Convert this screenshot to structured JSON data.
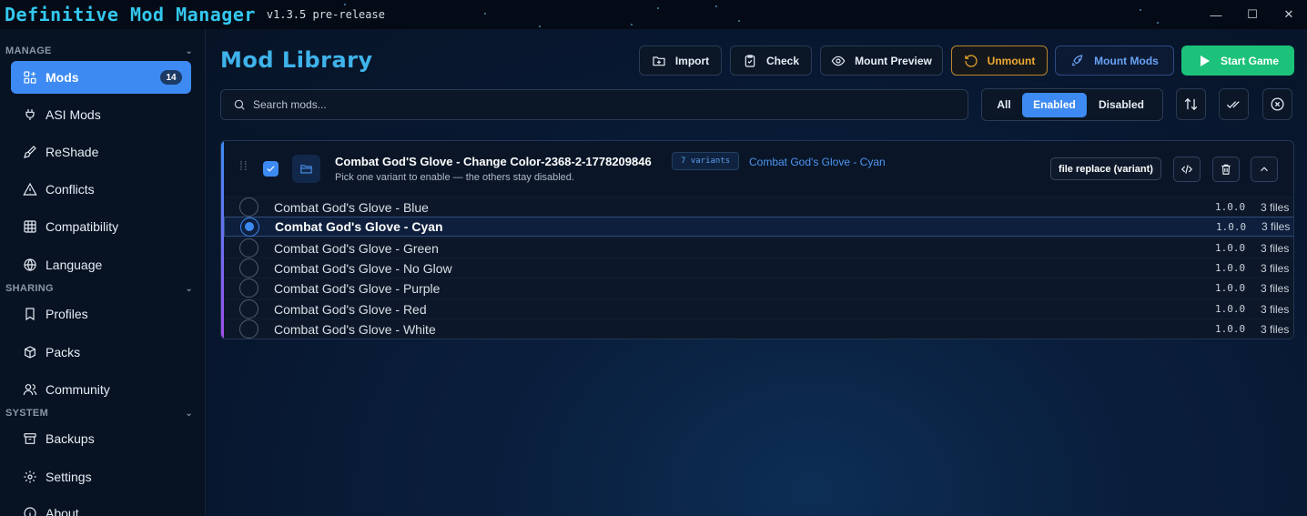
{
  "app": {
    "title": "Definitive Mod Manager",
    "version": "v1.3.5 pre-release",
    "accent_color": "#3d8af2"
  },
  "window_controls": {
    "minimize": "—",
    "maximize": "☐",
    "close": "✕"
  },
  "sidebar": {
    "sections": [
      {
        "label": "MANAGE"
      },
      {
        "label": "SHARING"
      },
      {
        "label": "SYSTEM"
      }
    ],
    "items": [
      {
        "label": "Mods",
        "icon": "mods-icon",
        "badge": "14",
        "active": true
      },
      {
        "label": "ASI Mods",
        "icon": "plug-icon"
      },
      {
        "label": "ReShade",
        "icon": "brush-icon"
      },
      {
        "label": "Conflicts",
        "icon": "warning-icon"
      },
      {
        "label": "Compatibility",
        "icon": "grid-icon"
      },
      {
        "label": "Language",
        "icon": "globe-icon"
      },
      {
        "label": "Profiles",
        "icon": "bookmark-icon"
      },
      {
        "label": "Packs",
        "icon": "package-icon"
      },
      {
        "label": "Community",
        "icon": "users-icon"
      },
      {
        "label": "Backups",
        "icon": "archive-icon"
      },
      {
        "label": "Settings",
        "icon": "gear-icon"
      },
      {
        "label": "About",
        "icon": "info-icon"
      }
    ]
  },
  "main": {
    "title": "Mod Library",
    "toolbar": {
      "import": "Import",
      "check": "Check",
      "mount_preview": "Mount Preview",
      "unmount": "Unmount",
      "mount_mods": "Mount Mods",
      "start_game": "Start Game"
    },
    "search": {
      "placeholder": "Search mods...",
      "value": ""
    },
    "filters": {
      "all": "All",
      "enabled": "Enabled",
      "disabled": "Disabled",
      "selected": "Enabled"
    }
  },
  "mod": {
    "name": "Combat God'S Glove - Change Color-2368-2-1778209846",
    "enabled": true,
    "variants_count": "7 variants",
    "selected_variant": "Combat God's Glove - Cyan",
    "description": "Pick one variant to enable — the others stay disabled.",
    "type": "file replace (variant)",
    "variants": [
      {
        "name": "Combat God's Glove - Blue",
        "version": "1.0.0",
        "files": "3 files",
        "selected": false
      },
      {
        "name": "Combat God's Glove - Cyan",
        "version": "1.0.0",
        "files": "3 files",
        "selected": true
      },
      {
        "name": "Combat God's Glove - Green",
        "version": "1.0.0",
        "files": "3 files",
        "selected": false
      },
      {
        "name": "Combat God's Glove - No Glow",
        "version": "1.0.0",
        "files": "3 files",
        "selected": false
      },
      {
        "name": "Combat God's Glove - Purple",
        "version": "1.0.0",
        "files": "3 files",
        "selected": false
      },
      {
        "name": "Combat God's Glove - Red",
        "version": "1.0.0",
        "files": "3 files",
        "selected": false
      },
      {
        "name": "Combat God's Glove - White",
        "version": "1.0.0",
        "files": "3 files",
        "selected": false
      }
    ]
  }
}
